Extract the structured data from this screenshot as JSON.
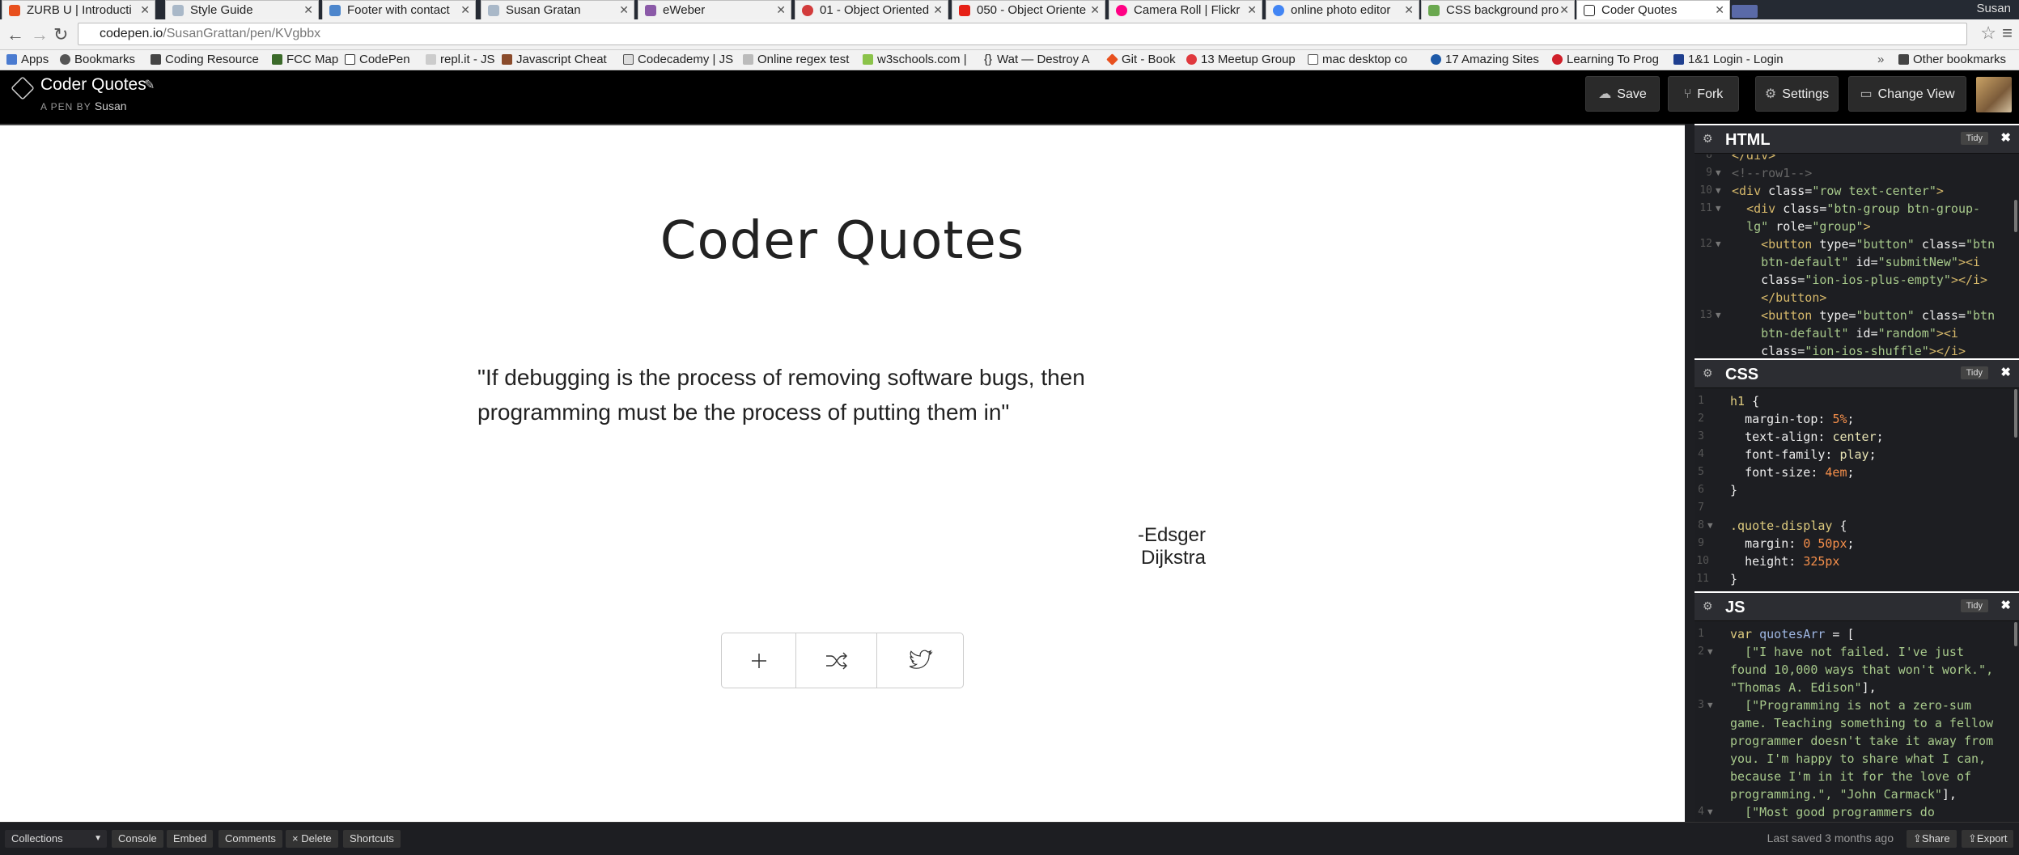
{
  "browser": {
    "tabs": [
      {
        "label": "ZURB U | Introducti",
        "color": "#e8501e"
      },
      {
        "label": "Style Guide",
        "color": "#a9b8c8"
      },
      {
        "label": "Footer with contact",
        "color": "#4d86cc"
      },
      {
        "label": "Susan Gratan",
        "color": "#a9b8c8"
      },
      {
        "label": "eWeber",
        "color": "#8b5aa8"
      },
      {
        "label": "01 - Object Oriented",
        "color": "#d23b3b"
      },
      {
        "label": "050 - Object Oriente",
        "color": "#e62117"
      },
      {
        "label": "Camera Roll | Flickr",
        "color": "#ff0084"
      },
      {
        "label": "online photo editor",
        "color": "#4285f4"
      },
      {
        "label": "CSS background pro",
        "color": "#6aa84f"
      },
      {
        "label": "Coder Quotes",
        "color": "#222222"
      }
    ],
    "user": "Susan",
    "url_host": "codepen.io",
    "url_path": "/SusanGrattan/pen/KVgbbx",
    "bookmarks": [
      "Apps",
      "Bookmarks",
      "Coding Resource",
      "FCC Map",
      "CodePen",
      "repl.it - JS",
      "Javascript Cheat",
      "Codecademy | JS",
      "Online regex test",
      "w3schools.com |",
      "Wat — Destroy A",
      "Git - Book",
      "13 Meetup Group",
      "mac desktop co",
      "17 Amazing Sites",
      "Learning To Prog",
      "1&1 Login - Login"
    ],
    "other_bookmarks": "Other bookmarks"
  },
  "header": {
    "title": "Coder Quotes",
    "by_prefix": "A PEN BY",
    "author": "Susan",
    "save_label": "Save",
    "fork_label": "Fork",
    "settings_label": "Settings",
    "change_view_label": "Change View"
  },
  "preview": {
    "heading": "Coder Quotes",
    "quote": "\"If debugging is the process of removing software bugs, then programming must be the process of putting them in\"",
    "author": "-Edsger Dijkstra",
    "buttons": [
      "plus-icon",
      "shuffle-icon",
      "twitter-icon"
    ]
  },
  "panels": {
    "html": {
      "title": "HTML",
      "tidy": "Tidy"
    },
    "css": {
      "title": "CSS",
      "tidy": "Tidy"
    },
    "js": {
      "title": "JS",
      "tidy": "Tidy"
    }
  },
  "footer": {
    "collections": "Collections",
    "console": "Console",
    "embed": "Embed",
    "comments": "Comments",
    "delete": "× Delete",
    "shortcuts": "Shortcuts",
    "last_saved": "Last saved 3 months ago",
    "share": "Share",
    "export": "Export"
  },
  "colors": {
    "accent_dark": "#1d1e22",
    "header_bg": "#000000"
  }
}
